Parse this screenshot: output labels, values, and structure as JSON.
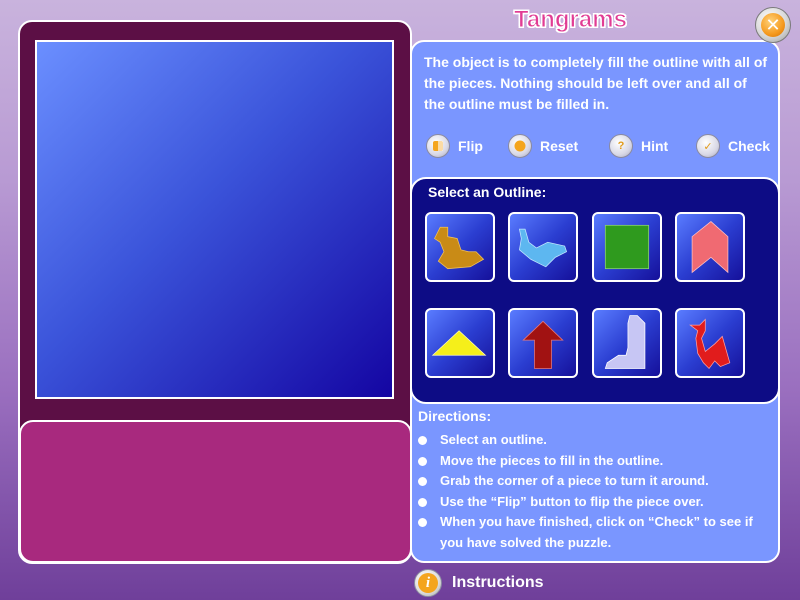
{
  "app": {
    "title": "Tangrams"
  },
  "window": {
    "close_icon": "close-icon"
  },
  "intro_text": "The object is to completely fill the outline with all of the pieces.  Nothing should be left over and all of the outline must be filled in.",
  "toolbar": [
    {
      "label": "Flip",
      "icon": "flip-icon"
    },
    {
      "label": "Reset",
      "icon": "reset-icon"
    },
    {
      "label": "Hint",
      "icon": "hint-icon"
    },
    {
      "label": "Check",
      "icon": "check-icon"
    }
  ],
  "outlines": {
    "title": "Select an Outline:",
    "items": [
      {
        "name": "duck",
        "color": "#c98b16"
      },
      {
        "name": "boat",
        "color": "#5db7f0"
      },
      {
        "name": "square",
        "color": "#2f9a1e"
      },
      {
        "name": "arrow-bookmark",
        "color": "#f06a72"
      },
      {
        "name": "triangle",
        "color": "#f5ef1a"
      },
      {
        "name": "arrow-up",
        "color": "#a11212"
      },
      {
        "name": "boot",
        "color": "#c7c6f4"
      },
      {
        "name": "bird",
        "color": "#e11c1c"
      }
    ]
  },
  "directions": {
    "title": "Directions:",
    "items": [
      "Select an outline.",
      "Move the pieces to fill in the outline.",
      "Grab the corner of a piece to turn it around.",
      "Use the “Flip” button to flip the piece over.",
      "When you have finished, click on “Check” to see if you have solved the puzzle."
    ]
  },
  "instructions": {
    "label": "Instructions",
    "icon": "info-icon"
  },
  "colors": {
    "frame": "#5c0f45",
    "tray": "#a8297e",
    "panel": "#7a96ff",
    "outline_panel": "#0d0c85",
    "title": "#e13c94"
  }
}
